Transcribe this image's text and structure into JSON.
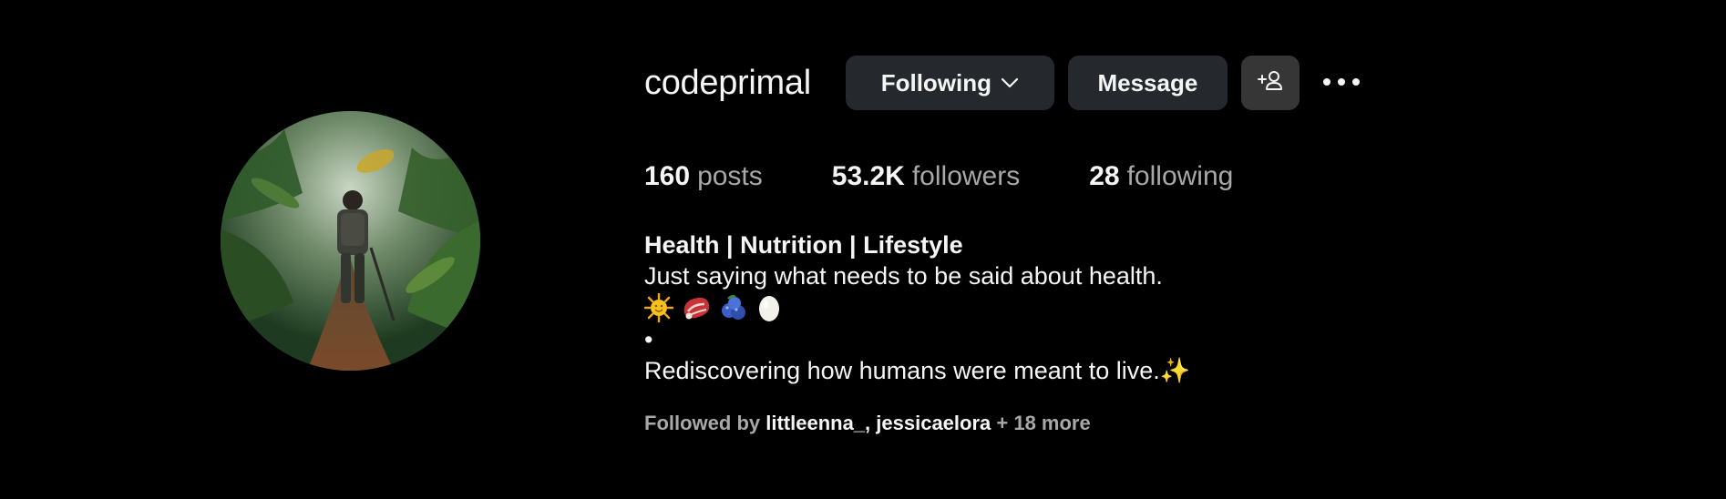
{
  "profile": {
    "username": "codeprimal",
    "avatar_alt": "person hiking through a jungle",
    "buttons": {
      "following_label": "Following",
      "message_label": "Message",
      "suggest_icon": "add-person-icon",
      "more_icon": "more-horizontal-icon"
    },
    "stats": {
      "posts": {
        "value": "160",
        "label": "posts"
      },
      "followers": {
        "value": "53.2K",
        "label": "followers"
      },
      "following": {
        "value": "28",
        "label": "following"
      }
    },
    "bio": {
      "name": "Health | Nutrition | Lifestyle",
      "line1": "Just saying what needs to be said about health.",
      "emojis": [
        "sun-emoji",
        "meat-emoji",
        "blueberries-emoji",
        "egg-emoji"
      ],
      "bullet": "•",
      "line3": "Rediscovering how humans were meant to live.✨"
    },
    "followed_by": {
      "prefix": "Followed by ",
      "user1": "littleenna_",
      "separator": ", ",
      "user2": "jessicaelora",
      "suffix": " + 18 more"
    }
  },
  "colors": {
    "background": "#000000",
    "button_bg": "#25292e",
    "secondary_text": "#a8a8a8",
    "primary_text": "#f5f5f5"
  }
}
